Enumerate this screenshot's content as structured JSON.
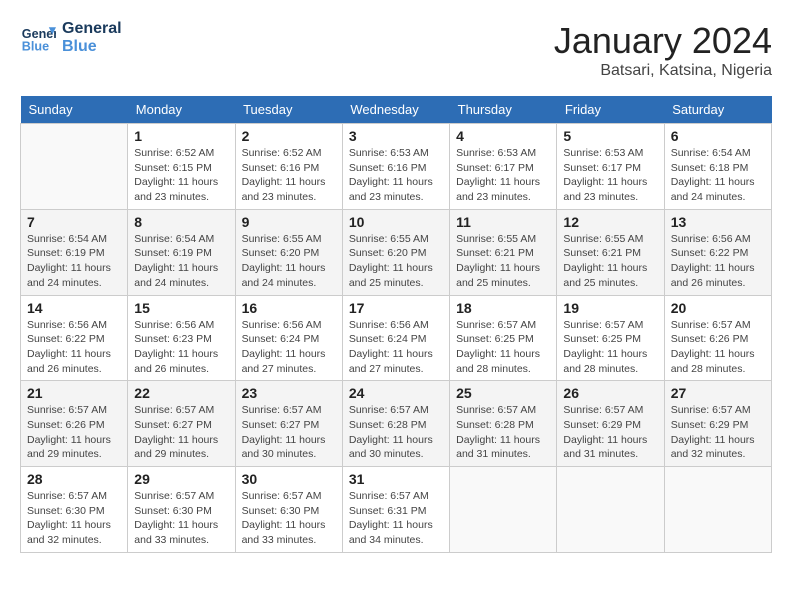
{
  "logo": {
    "line1": "General",
    "line2": "Blue"
  },
  "title": "January 2024",
  "subtitle": "Batsari, Katsina, Nigeria",
  "columns": [
    "Sunday",
    "Monday",
    "Tuesday",
    "Wednesday",
    "Thursday",
    "Friday",
    "Saturday"
  ],
  "weeks": [
    [
      {
        "day": "",
        "info": ""
      },
      {
        "day": "1",
        "info": "Sunrise: 6:52 AM\nSunset: 6:15 PM\nDaylight: 11 hours\nand 23 minutes."
      },
      {
        "day": "2",
        "info": "Sunrise: 6:52 AM\nSunset: 6:16 PM\nDaylight: 11 hours\nand 23 minutes."
      },
      {
        "day": "3",
        "info": "Sunrise: 6:53 AM\nSunset: 6:16 PM\nDaylight: 11 hours\nand 23 minutes."
      },
      {
        "day": "4",
        "info": "Sunrise: 6:53 AM\nSunset: 6:17 PM\nDaylight: 11 hours\nand 23 minutes."
      },
      {
        "day": "5",
        "info": "Sunrise: 6:53 AM\nSunset: 6:17 PM\nDaylight: 11 hours\nand 23 minutes."
      },
      {
        "day": "6",
        "info": "Sunrise: 6:54 AM\nSunset: 6:18 PM\nDaylight: 11 hours\nand 24 minutes."
      }
    ],
    [
      {
        "day": "7",
        "info": "Sunrise: 6:54 AM\nSunset: 6:19 PM\nDaylight: 11 hours\nand 24 minutes."
      },
      {
        "day": "8",
        "info": "Sunrise: 6:54 AM\nSunset: 6:19 PM\nDaylight: 11 hours\nand 24 minutes."
      },
      {
        "day": "9",
        "info": "Sunrise: 6:55 AM\nSunset: 6:20 PM\nDaylight: 11 hours\nand 24 minutes."
      },
      {
        "day": "10",
        "info": "Sunrise: 6:55 AM\nSunset: 6:20 PM\nDaylight: 11 hours\nand 25 minutes."
      },
      {
        "day": "11",
        "info": "Sunrise: 6:55 AM\nSunset: 6:21 PM\nDaylight: 11 hours\nand 25 minutes."
      },
      {
        "day": "12",
        "info": "Sunrise: 6:55 AM\nSunset: 6:21 PM\nDaylight: 11 hours\nand 25 minutes."
      },
      {
        "day": "13",
        "info": "Sunrise: 6:56 AM\nSunset: 6:22 PM\nDaylight: 11 hours\nand 26 minutes."
      }
    ],
    [
      {
        "day": "14",
        "info": "Sunrise: 6:56 AM\nSunset: 6:22 PM\nDaylight: 11 hours\nand 26 minutes."
      },
      {
        "day": "15",
        "info": "Sunrise: 6:56 AM\nSunset: 6:23 PM\nDaylight: 11 hours\nand 26 minutes."
      },
      {
        "day": "16",
        "info": "Sunrise: 6:56 AM\nSunset: 6:24 PM\nDaylight: 11 hours\nand 27 minutes."
      },
      {
        "day": "17",
        "info": "Sunrise: 6:56 AM\nSunset: 6:24 PM\nDaylight: 11 hours\nand 27 minutes."
      },
      {
        "day": "18",
        "info": "Sunrise: 6:57 AM\nSunset: 6:25 PM\nDaylight: 11 hours\nand 28 minutes."
      },
      {
        "day": "19",
        "info": "Sunrise: 6:57 AM\nSunset: 6:25 PM\nDaylight: 11 hours\nand 28 minutes."
      },
      {
        "day": "20",
        "info": "Sunrise: 6:57 AM\nSunset: 6:26 PM\nDaylight: 11 hours\nand 28 minutes."
      }
    ],
    [
      {
        "day": "21",
        "info": "Sunrise: 6:57 AM\nSunset: 6:26 PM\nDaylight: 11 hours\nand 29 minutes."
      },
      {
        "day": "22",
        "info": "Sunrise: 6:57 AM\nSunset: 6:27 PM\nDaylight: 11 hours\nand 29 minutes."
      },
      {
        "day": "23",
        "info": "Sunrise: 6:57 AM\nSunset: 6:27 PM\nDaylight: 11 hours\nand 30 minutes."
      },
      {
        "day": "24",
        "info": "Sunrise: 6:57 AM\nSunset: 6:28 PM\nDaylight: 11 hours\nand 30 minutes."
      },
      {
        "day": "25",
        "info": "Sunrise: 6:57 AM\nSunset: 6:28 PM\nDaylight: 11 hours\nand 31 minutes."
      },
      {
        "day": "26",
        "info": "Sunrise: 6:57 AM\nSunset: 6:29 PM\nDaylight: 11 hours\nand 31 minutes."
      },
      {
        "day": "27",
        "info": "Sunrise: 6:57 AM\nSunset: 6:29 PM\nDaylight: 11 hours\nand 32 minutes."
      }
    ],
    [
      {
        "day": "28",
        "info": "Sunrise: 6:57 AM\nSunset: 6:30 PM\nDaylight: 11 hours\nand 32 minutes."
      },
      {
        "day": "29",
        "info": "Sunrise: 6:57 AM\nSunset: 6:30 PM\nDaylight: 11 hours\nand 33 minutes."
      },
      {
        "day": "30",
        "info": "Sunrise: 6:57 AM\nSunset: 6:30 PM\nDaylight: 11 hours\nand 33 minutes."
      },
      {
        "day": "31",
        "info": "Sunrise: 6:57 AM\nSunset: 6:31 PM\nDaylight: 11 hours\nand 34 minutes."
      },
      {
        "day": "",
        "info": ""
      },
      {
        "day": "",
        "info": ""
      },
      {
        "day": "",
        "info": ""
      }
    ]
  ]
}
